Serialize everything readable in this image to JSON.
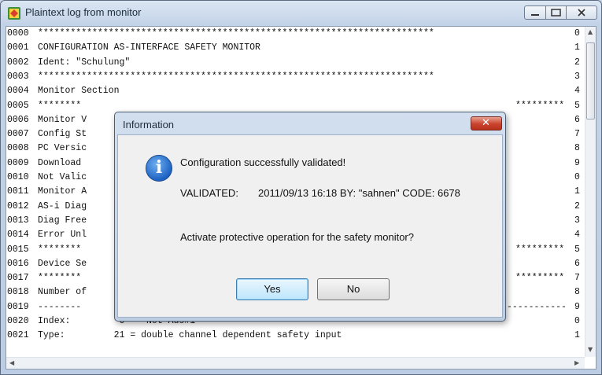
{
  "window": {
    "title": "Plaintext log from monitor"
  },
  "log": {
    "lines": [
      {
        "num": "0000",
        "text": "*************************************************************************",
        "right": "0"
      },
      {
        "num": "0001",
        "text": "CONFIGURATION AS-INTERFACE SAFETY MONITOR",
        "right": "1"
      },
      {
        "num": "0002",
        "text": "Ident: \"Schulung\"",
        "right": "2"
      },
      {
        "num": "0003",
        "text": "*************************************************************************",
        "right": "3"
      },
      {
        "num": "0004",
        "text": "Monitor Section",
        "right": "4"
      },
      {
        "num": "0005",
        "text": "********",
        "right": "5"
      },
      {
        "num": "0006",
        "text": "Monitor V",
        "right": "6"
      },
      {
        "num": "0007",
        "text": "Config St",
        "right": "7"
      },
      {
        "num": "0008",
        "text": "PC Versic",
        "right": "8"
      },
      {
        "num": "0009",
        "text": "Download",
        "right": "9"
      },
      {
        "num": "0010",
        "text": "Not Valic",
        "right": "0"
      },
      {
        "num": "0011",
        "text": "Monitor A",
        "right": "1"
      },
      {
        "num": "0012",
        "text": "AS-i Diag",
        "right": "2"
      },
      {
        "num": "0013",
        "text": "Diag Free",
        "right": "3"
      },
      {
        "num": "0014",
        "text": "Error Unl",
        "right": "4"
      },
      {
        "num": "0015",
        "text": "********",
        "right": "5"
      },
      {
        "num": "0016",
        "text": "Device Se",
        "right": "6"
      },
      {
        "num": "0017",
        "text": "********",
        "right": "7"
      },
      {
        "num": "0018",
        "text": "Number of",
        "right": "8"
      },
      {
        "num": "0019",
        "text": "--------",
        "right": "9"
      },
      {
        "num": "0020",
        "text": "Index:         0 = \"Not-Aus#1\"",
        "right": "0"
      },
      {
        "num": "0021",
        "text": "Type:         21 = double channel dependent safety input",
        "right": "1"
      }
    ],
    "stars_tail": "*********",
    "dash_tail": "-----------"
  },
  "dialog": {
    "title": "Information",
    "message": "Configuration successfully validated!",
    "validated_label": "VALIDATED:",
    "validated_info": "2011/09/13 16:18 BY: \"sahnen\" CODE: 6678",
    "question": "Activate protective operation for the safety monitor?",
    "yes_label": "Yes",
    "no_label": "No",
    "icon": "info-icon",
    "close_glyph": "✕"
  },
  "colors": {
    "close_button": "#c9432d",
    "info_icon": "#1e63c4",
    "default_button": "#bde6fd"
  }
}
